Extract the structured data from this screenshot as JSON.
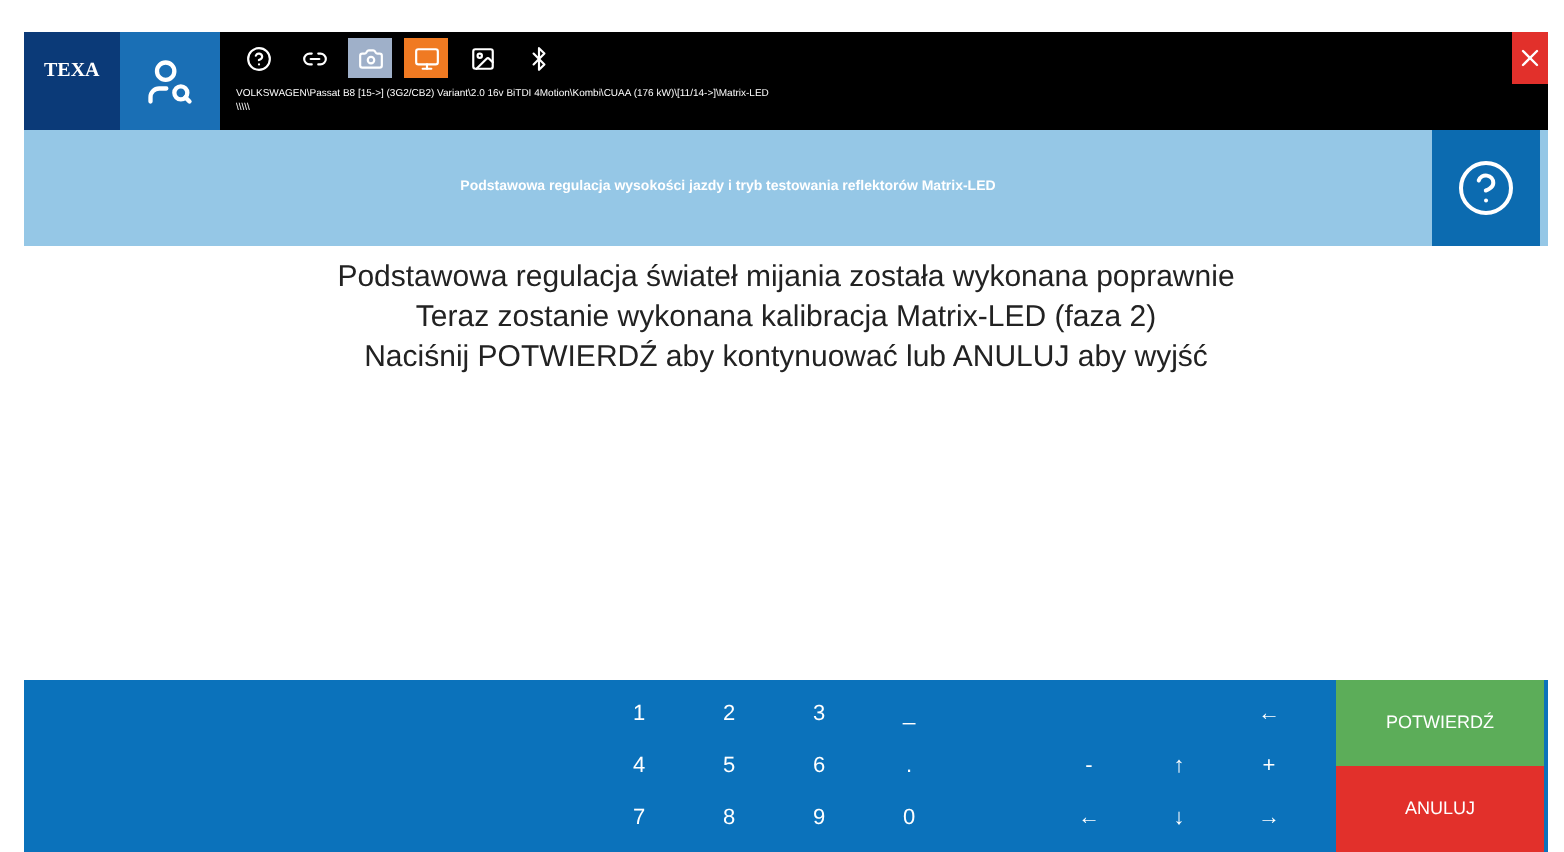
{
  "header": {
    "logo": "TEXA",
    "vehicle": "VOLKSWAGEN\\Passat B8 [15->] (3G2/CB2) Variant\\2.0 16v BiTDI 4Motion\\Kombi\\CUAA (176 kW)\\[11/14->]\\Matrix-LED",
    "vehicle_line2": "\\\\\\\\\\"
  },
  "toolbar": [
    {
      "kind": "help"
    },
    {
      "kind": "link"
    },
    {
      "kind": "camera",
      "color": "#9fb0c9"
    },
    {
      "kind": "device",
      "color": "#f07a22"
    },
    {
      "kind": "image"
    },
    {
      "kind": "bluetooth"
    }
  ],
  "title": "Podstawowa regulacja wysokości jazdy i tryb testowania reflektorów Matrix-LED",
  "message": [
    "Podstawowa regulacja świateł mijania została wykonana poprawnie",
    "Teraz zostanie wykonana kalibracja Matrix-LED (faza 2)",
    "Naciśnij POTWIERDŹ aby kontynuować lub ANULUJ aby wyjść"
  ],
  "keypad": {
    "digits": [
      [
        "1",
        "2",
        "3",
        "_"
      ],
      [
        "4",
        "5",
        "6",
        "."
      ],
      [
        "7",
        "8",
        "9",
        "0"
      ]
    ],
    "navigation": [
      [
        "←"
      ],
      [
        "-",
        "↑",
        "+"
      ],
      [
        "←",
        "↓",
        "→"
      ]
    ]
  },
  "buttons": [
    {
      "kind": "confirm",
      "label": "POTWIERDŹ"
    },
    {
      "kind": "cancel",
      "label": "ANULUJ"
    }
  ]
}
